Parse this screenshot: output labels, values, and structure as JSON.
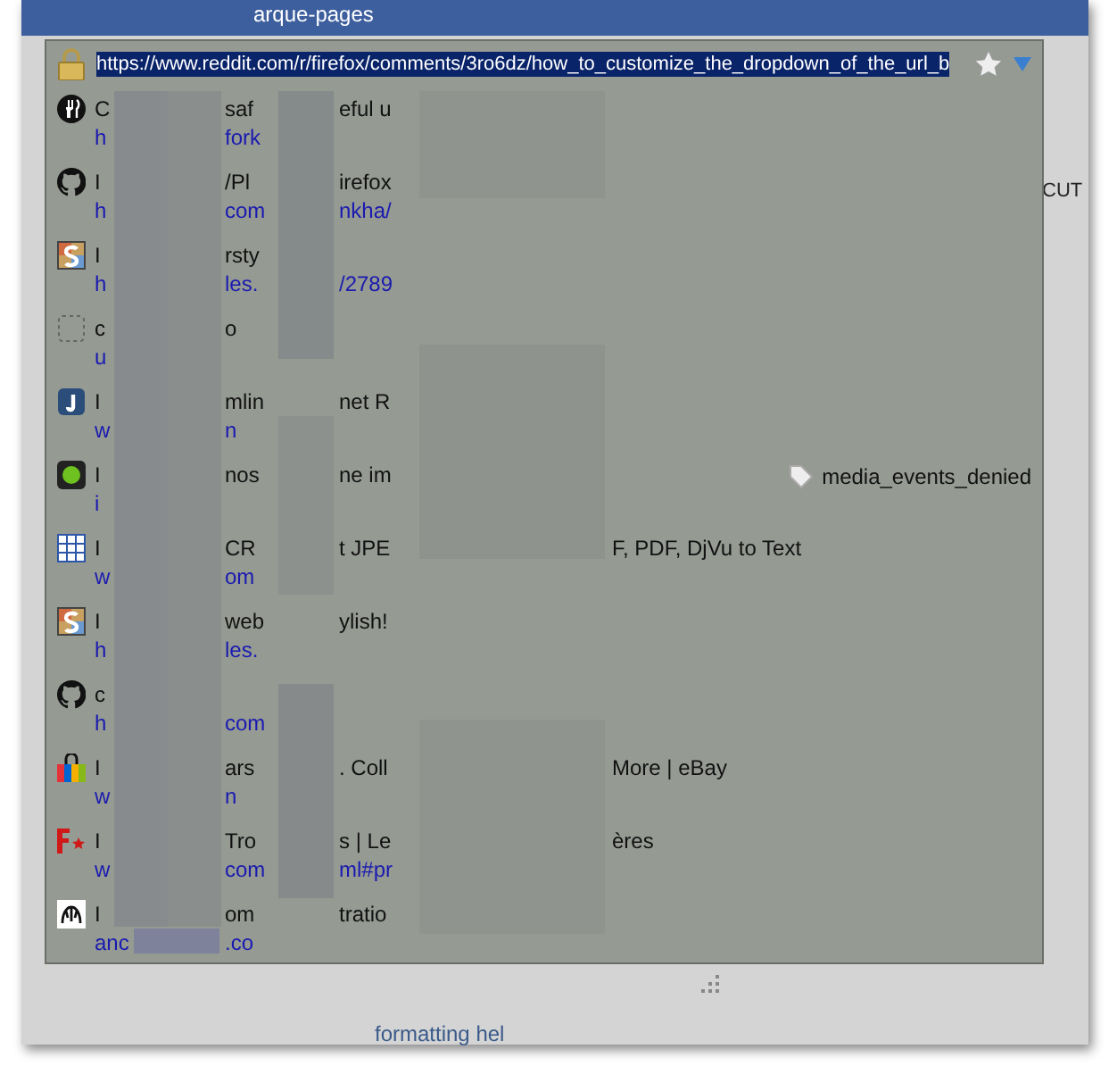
{
  "background": {
    "menu_text": "arque-pages",
    "toolbar_label": "CUT",
    "footer_link": "formatting hel"
  },
  "url_bar": {
    "value": "https://www.reddit.com/r/firefox/comments/3ro6dz/how_to_customize_the_dropdown_of_the_url_b",
    "text_selected": true
  },
  "results": [
    {
      "kind": "fork",
      "title_fragments": [
        "C",
        "saf",
        "eful u"
      ],
      "url_fragments": [
        "h",
        "fork"
      ]
    },
    {
      "kind": "github",
      "title_fragments": [
        "I",
        "/Pl",
        "irefox"
      ],
      "url_fragments": [
        "h",
        "com",
        "nkha/"
      ]
    },
    {
      "kind": "stylish",
      "title_fragments": [
        "I",
        "rsty"
      ],
      "url_fragments": [
        "h",
        "les.",
        "/2789"
      ]
    },
    {
      "kind": "blank",
      "title_fragments": [
        "c",
        "o"
      ],
      "url_fragments": [
        "u"
      ]
    },
    {
      "kind": "j",
      "title_fragments": [
        "I",
        "mlin",
        "net R"
      ],
      "url_fragments": [
        "w",
        "n"
      ]
    },
    {
      "kind": "green-dot",
      "title_fragments": [
        "I",
        "nos",
        "ne im"
      ],
      "url_fragments": [
        "i"
      ],
      "tag": "media_events_denied"
    },
    {
      "kind": "grid",
      "title_fragments": [
        "I",
        "CR",
        "t JPE",
        "F, PDF, DjVu to Text"
      ],
      "url_fragments": [
        "w",
        "om"
      ]
    },
    {
      "kind": "stylish",
      "title_fragments": [
        "I",
        "web",
        "ylish!"
      ],
      "url_fragments": [
        "h",
        "les."
      ]
    },
    {
      "kind": "github",
      "title_fragments": [
        "c"
      ],
      "url_fragments": [
        "h",
        "com"
      ]
    },
    {
      "kind": "bag",
      "title_fragments": [
        "I",
        "ars",
        ". Coll",
        "More | eBay"
      ],
      "url_fragments": [
        "w",
        "n"
      ]
    },
    {
      "kind": "fstar",
      "title_fragments": [
        "I",
        "Tro",
        "s | Le",
        "ères"
      ],
      "url_fragments": [
        "w",
        "com",
        "ml#pr"
      ]
    },
    {
      "kind": "photo",
      "title_fragments": [
        "I",
        "om",
        "tratio"
      ],
      "url_fragments": [
        "anc",
        ".co"
      ]
    }
  ]
}
